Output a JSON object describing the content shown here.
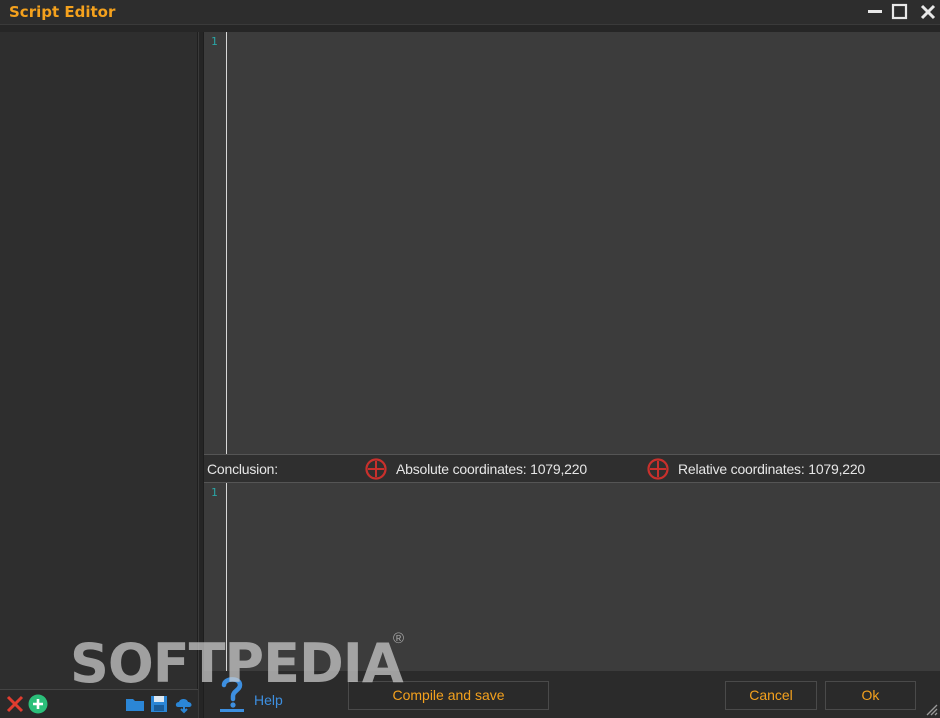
{
  "window": {
    "title": "Script Editor",
    "controls": {
      "minimize_icon": "minimize-icon",
      "maximize_icon": "maximize-icon",
      "close_icon": "close-icon"
    }
  },
  "editor_top": {
    "line_numbers": [
      "1"
    ]
  },
  "editor_bottom": {
    "line_numbers": [
      "1"
    ]
  },
  "conclusion": {
    "label": "Conclusion:",
    "absolute": "Absolute coordinates: 1079,220",
    "relative": "Relative coordinates: 1079,220",
    "icon": "crosshair-icon"
  },
  "bottom": {
    "help_label": "Help",
    "compile_label": "Compile and save",
    "cancel_label": "Cancel",
    "ok_label": "Ok"
  },
  "left_toolbar": {
    "icons": [
      "delete-icon",
      "add-icon",
      "folder-icon",
      "save-icon",
      "cloud-icon"
    ]
  },
  "watermark": {
    "text": "SOFTPEDIA",
    "mark": "®"
  },
  "colors": {
    "accent": "#f4a11d",
    "link": "#3d8fe0",
    "crosshair": "#c9302c",
    "line_number": "#2aa6a6",
    "editor_bg": "#3c3c3c"
  }
}
